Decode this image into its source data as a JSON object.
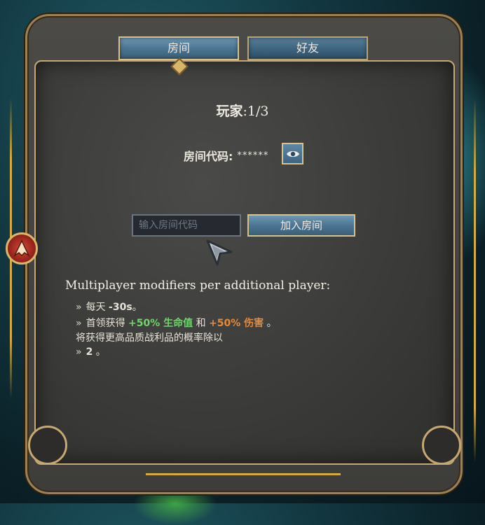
{
  "tabs": [
    {
      "label": "房间",
      "active": true
    },
    {
      "label": "好友",
      "active": false
    }
  ],
  "room": {
    "players_label": "玩家",
    "players_colon": ":",
    "players_count": "1/3",
    "code_label": "房间代码:",
    "code_value": "******",
    "code_input_placeholder": "输入房间代码",
    "join_button": "加入房间"
  },
  "modifiers": {
    "title": "Multiplayer modifiers per additional player:",
    "items": [
      {
        "bullet": "»",
        "text_a": "每天 ",
        "value": "-30s",
        "text_b": "。"
      },
      {
        "bullet": "»",
        "text_a": "首领获得 ",
        "green": "+50% 生命值",
        "text_mid": " 和 ",
        "orange": "+50% 伤害",
        "text_b": " 。"
      },
      {
        "bullet": "»",
        "line1": "将获得更高品质战利品的概率除以",
        "line2_value": "2",
        "line2_suffix": " 。"
      }
    ]
  },
  "colors": {
    "accent_gold": "#d9c18d",
    "button_blue": "#4b7592",
    "positive": "#6ed66a",
    "negative": "#e58a3c"
  },
  "icons": [
    "eye-icon",
    "cursor-arrow-icon",
    "faction-badge-icon"
  ]
}
